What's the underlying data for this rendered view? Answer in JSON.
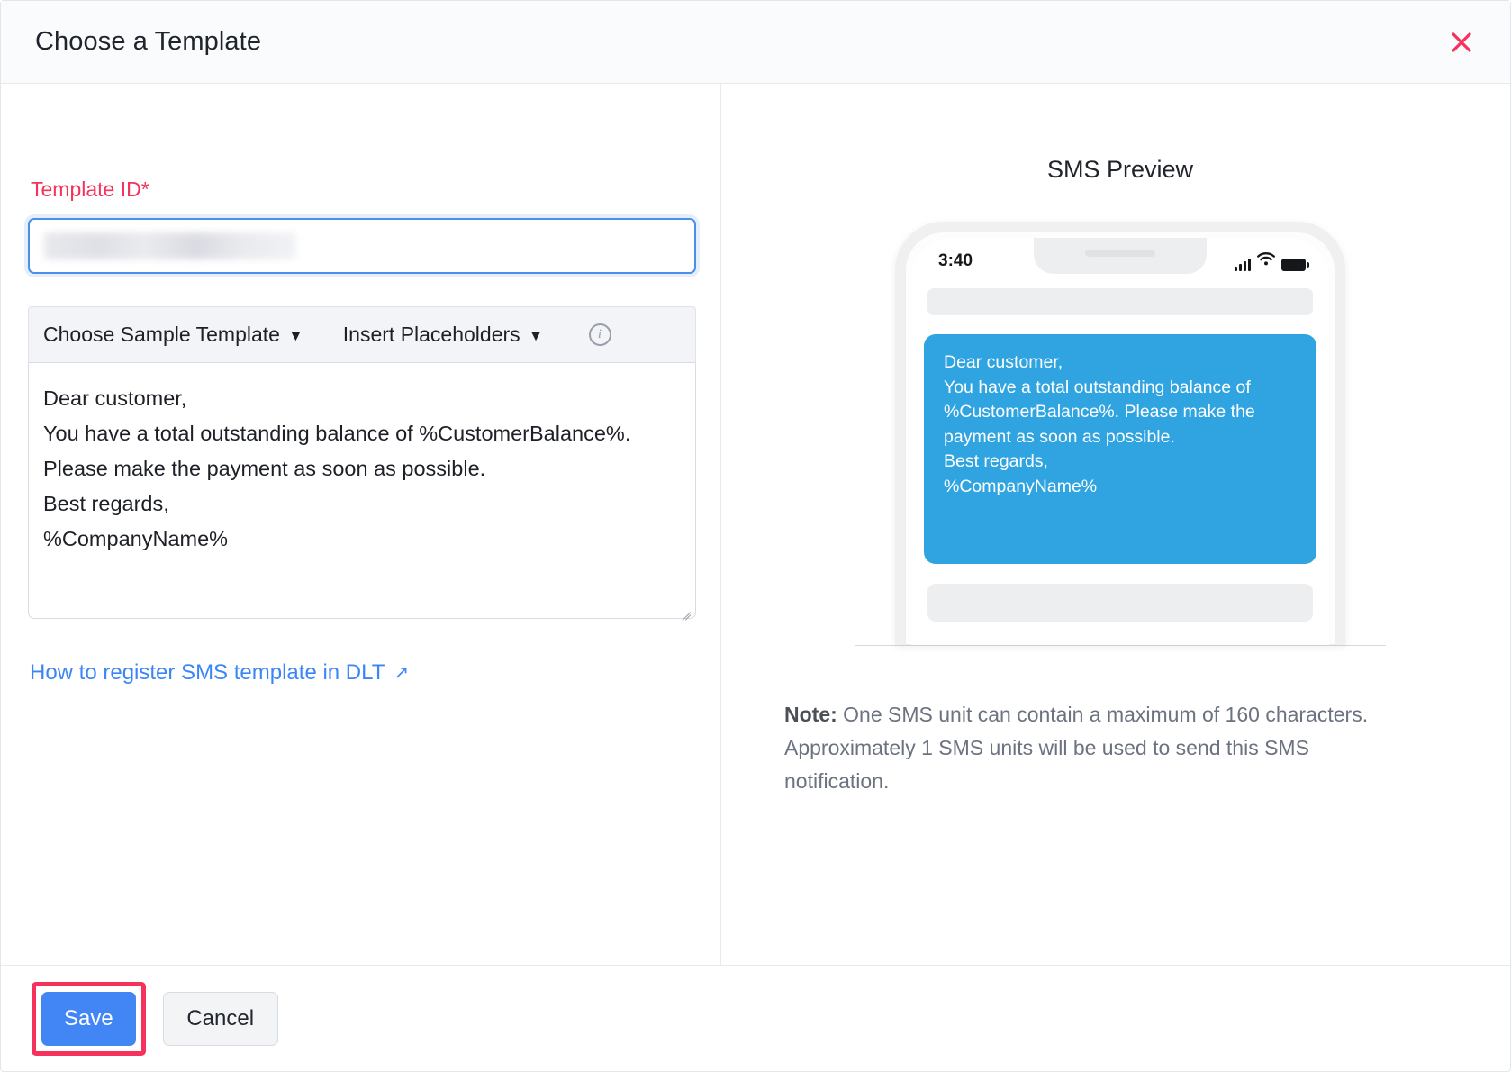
{
  "dialog": {
    "title": "Choose a Template",
    "close_icon": "close-icon"
  },
  "form": {
    "template_id_label": "Template ID*",
    "template_id_value": "",
    "template_id_placeholder": "",
    "template_id_redacted": true,
    "toolbar": {
      "choose_sample_template": "Choose Sample Template",
      "insert_placeholders": "Insert Placeholders",
      "caret": "▼",
      "info_icon": "info-icon",
      "info_glyph": "i"
    },
    "message_body": "Dear customer,\nYou have a total outstanding balance of %CustomerBalance%. Please make the payment as soon as possible.\nBest regards,\n%CompanyName%",
    "dlt_link": "How to register SMS template in DLT",
    "dlt_link_arrow": "↗"
  },
  "preview": {
    "title": "SMS Preview",
    "phone": {
      "time": "3:40",
      "signal_icon": "signal-bars-icon",
      "wifi_icon": "wifi-icon",
      "battery_icon": "battery-icon"
    },
    "bubble_text": "Dear customer,\nYou have a total outstanding balance of %CustomerBalance%. Please make the payment as soon as possible.\nBest regards,\n%CompanyName%",
    "bubble_color": "#2fa4e1",
    "note_prefix": "Note:",
    "note_text": " One SMS unit can contain a maximum of 160 characters. Approximately 1 SMS units will be used to send this SMS notification."
  },
  "footer": {
    "save_label": "Save",
    "cancel_label": "Cancel",
    "save_accent": "#4285f4",
    "highlight_color": "#f5325b"
  }
}
